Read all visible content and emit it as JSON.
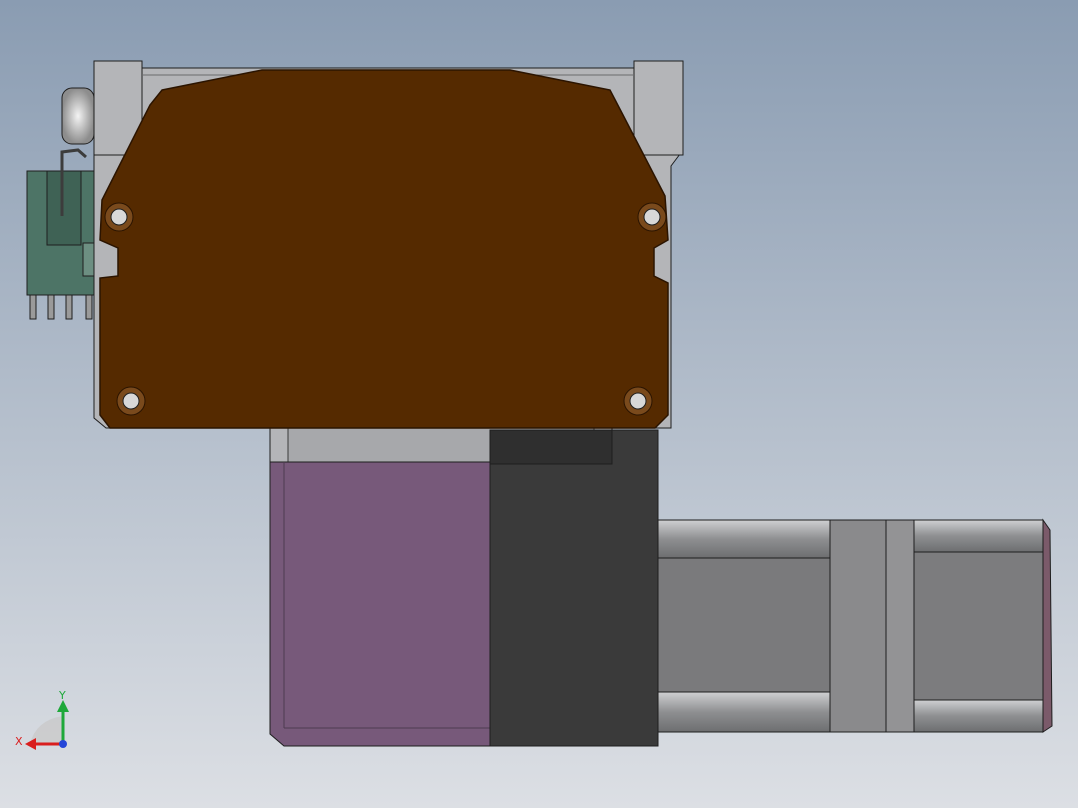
{
  "view": {
    "kind": "cad-assembly-viewport",
    "background_top": "#8a9cb2",
    "background_bottom": "#dcdfe4"
  },
  "colors": {
    "housing": "#b4b5b8",
    "housing_dark": "#7f8084",
    "plate": "#552a00",
    "plate_edge": "#2b1400",
    "connector": "#4d7466",
    "motor_body": "#77597a",
    "gearbox": "#3a3a3a",
    "shaft_metal": "#8c8c8e",
    "outline": "#1e1e1e"
  },
  "triad": {
    "x_label": "X",
    "y_label": "Y",
    "x_color": "#d91e1e",
    "y_color": "#1ea83a",
    "z_color": "#2446d8"
  },
  "parts": [
    "aluminum-housing",
    "brown-cover-plate",
    "side-connector",
    "purple-motor",
    "gearbox",
    "drive-shaft-assembly"
  ]
}
